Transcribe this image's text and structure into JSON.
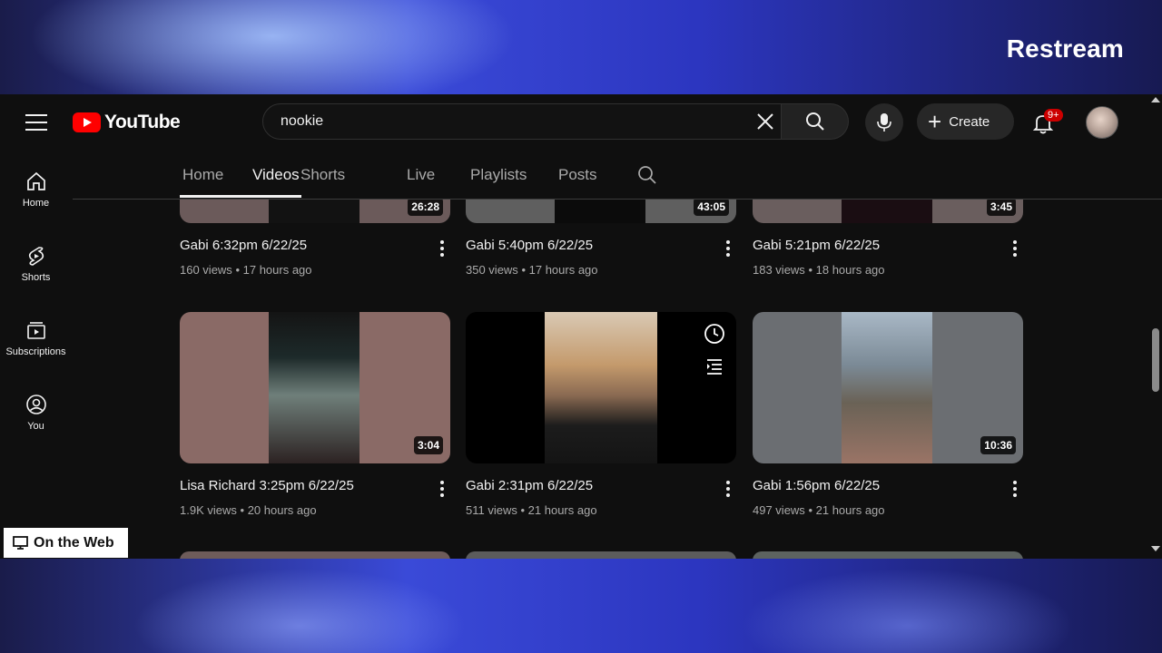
{
  "overlay": {
    "brand": "Restream",
    "badge_label": "On the Web"
  },
  "header": {
    "logo_text": "YouTube",
    "search": {
      "value": "nookie"
    },
    "create_label": "Create",
    "notifications_badge": "9+"
  },
  "rail": {
    "items": [
      {
        "label": "Home",
        "icon": "home-icon"
      },
      {
        "label": "Shorts",
        "icon": "shorts-icon"
      },
      {
        "label": "Subscriptions",
        "icon": "subscriptions-icon"
      },
      {
        "label": "You",
        "icon": "you-icon"
      }
    ]
  },
  "tabs": [
    {
      "label": "Home"
    },
    {
      "label": "Videos",
      "active": true
    },
    {
      "label": "Shorts"
    },
    {
      "label": "Live"
    },
    {
      "label": "Playlists"
    },
    {
      "label": "Posts"
    }
  ],
  "videos": [
    {
      "title": "Gabi 6:32pm 6/22/25",
      "views": "160 views",
      "age": "17 hours ago",
      "duration": "26:28"
    },
    {
      "title": "Gabi 5:40pm 6/22/25",
      "views": "350 views",
      "age": "17 hours ago",
      "duration": "43:05"
    },
    {
      "title": "Gabi 5:21pm 6/22/25",
      "views": "183 views",
      "age": "18 hours ago",
      "duration": "3:45"
    },
    {
      "title": "Lisa Richard 3:25pm 6/22/25",
      "views": "1.9K views",
      "age": "20 hours ago",
      "duration": "3:04"
    },
    {
      "title": "Gabi 2:31pm 6/22/25",
      "views": "511 views",
      "age": "21 hours ago",
      "duration": ""
    },
    {
      "title": "Gabi 1:56pm 6/22/25",
      "views": "497 views",
      "age": "21 hours ago",
      "duration": "10:36"
    }
  ],
  "meta_separator": "•"
}
